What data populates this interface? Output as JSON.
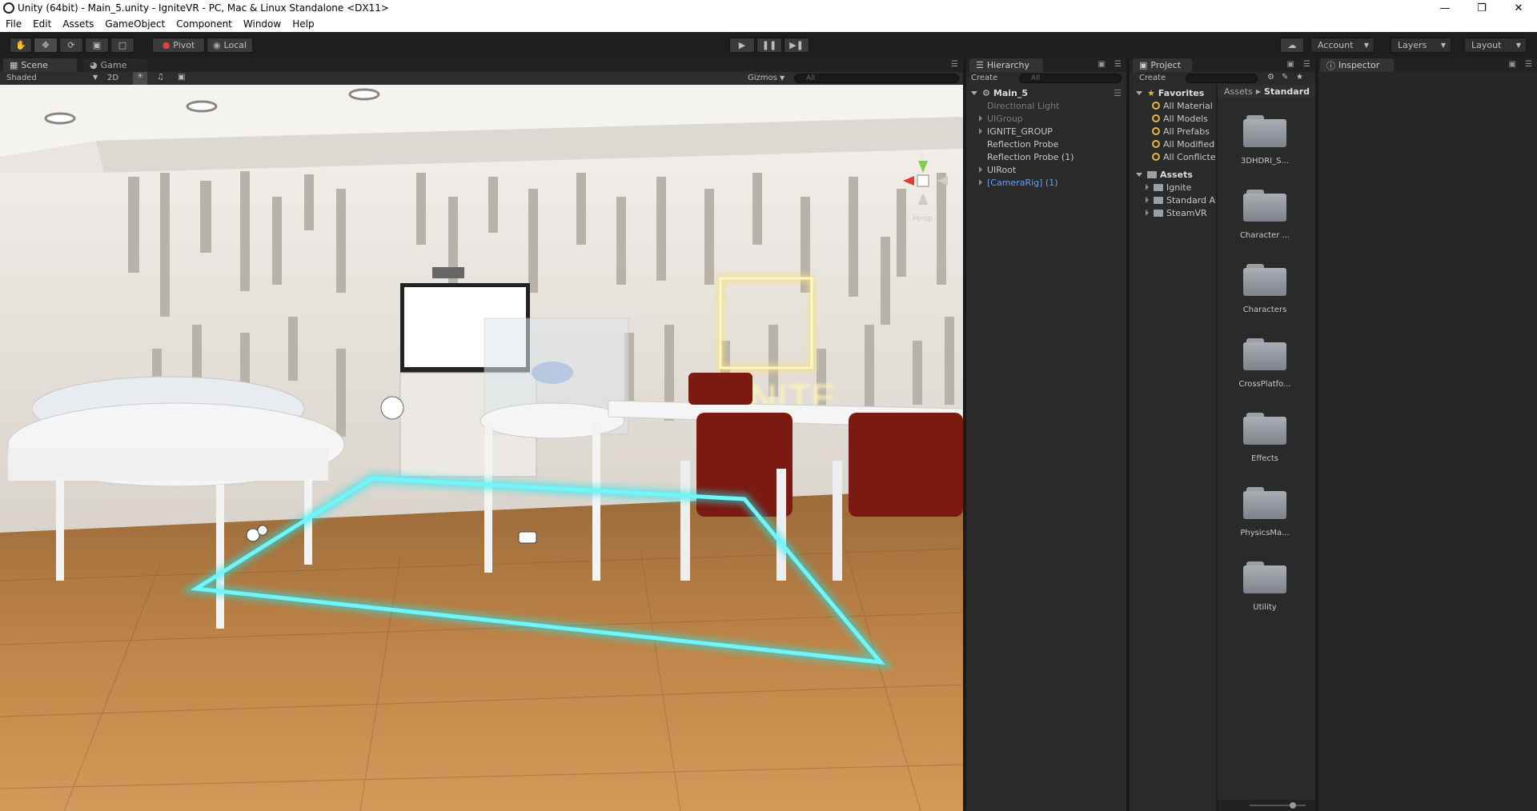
{
  "window": {
    "title": "Unity (64bit) - Main_5.unity - IgniteVR - PC, Mac & Linux Standalone <DX11>",
    "minimize_icon": "minimize-icon",
    "restore_icon": "restore-icon",
    "close_icon": "close-icon"
  },
  "menu": [
    "File",
    "Edit",
    "Assets",
    "GameObject",
    "Component",
    "Window",
    "Help"
  ],
  "toolbar": {
    "pivot_label": "Pivot",
    "local_label": "Local",
    "account_label": "Account",
    "layers_label": "Layers",
    "layout_label": "Layout"
  },
  "scene_panel": {
    "tab_scene": "Scene",
    "tab_game": "Game",
    "shading_mode": "Shaded",
    "mode_2d": "2D",
    "gizmos_label": "Gizmos",
    "search_placeholder": "All",
    "logo_text": "IGNITE",
    "gizmo_axis_y": "y",
    "gizmo_persp": "Persp"
  },
  "hierarchy": {
    "tab_label": "Hierarchy",
    "create_label": "Create",
    "search_placeholder": "All",
    "scene_name": "Main_5",
    "items": [
      {
        "label": "Directional Light",
        "expandable": false,
        "state": "inactive"
      },
      {
        "label": "UIGroup",
        "expandable": true,
        "state": "inactive"
      },
      {
        "label": "IGNITE_GROUP",
        "expandable": true,
        "state": "normal"
      },
      {
        "label": "Reflection Probe",
        "expandable": false,
        "state": "normal"
      },
      {
        "label": "Reflection Probe (1)",
        "expandable": false,
        "state": "normal"
      },
      {
        "label": "UIRoot",
        "expandable": true,
        "state": "normal"
      },
      {
        "label": "[CameraRig] (1)",
        "expandable": true,
        "state": "prefab"
      }
    ]
  },
  "project": {
    "tab_label": "Project",
    "create_label": "Create",
    "favorites_label": "Favorites",
    "favorites": [
      "All Material",
      "All Models",
      "All Prefabs",
      "All Modified",
      "All Conflicte"
    ],
    "assets_label": "Assets",
    "assets_children": [
      "Ignite",
      "Standard A",
      "SteamVR"
    ],
    "breadcrumb": [
      "Assets",
      "Standard"
    ],
    "folders": [
      "3DHDRI_S...",
      "Character ...",
      "Characters",
      "CrossPlatfo...",
      "Effects",
      "PhysicsMa...",
      "Utility"
    ]
  },
  "inspector": {
    "tab_label": "Inspector"
  },
  "colors": {
    "accent_cyan": "#1fe6f0",
    "prefab_blue": "#6f9ff5",
    "favorite_gold": "#e5b93a"
  }
}
